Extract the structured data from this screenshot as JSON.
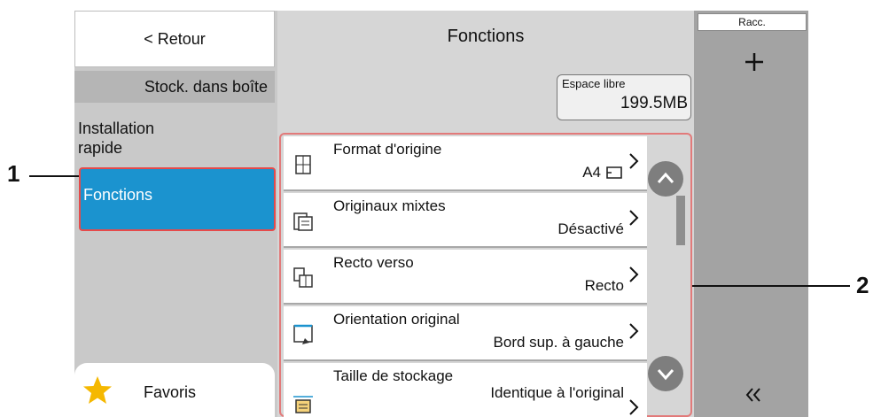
{
  "header": {
    "back_label": "< Retour",
    "title": "Fonctions",
    "shortcut_tab": "Racc."
  },
  "sidebar": {
    "box_label": "Stock. dans boîte",
    "items": [
      {
        "label": "Installation\nrapide"
      },
      {
        "label": "Fonctions"
      }
    ],
    "favorites_label": "Favoris"
  },
  "storage": {
    "label": "Espace libre",
    "value": "199.5MB"
  },
  "functions": [
    {
      "title": "Format d'origine",
      "value": "A4"
    },
    {
      "title": "Originaux mixtes",
      "value": "Désactivé"
    },
    {
      "title": "Recto verso",
      "value": "Recto"
    },
    {
      "title": "Orientation original",
      "value": "Bord sup. à gauche"
    },
    {
      "title": "Taille de stockage",
      "value": "Identique à l'original"
    }
  ],
  "callouts": {
    "one": "1",
    "two": "2"
  },
  "colors": {
    "selected": "#1b93cf",
    "callout_frame": "#e64a4a"
  },
  "icons": [
    "chevron-left-icon",
    "plus-icon",
    "star-icon",
    "chevron-up-icon",
    "chevron-down-icon",
    "double-chevron-left-icon"
  ]
}
